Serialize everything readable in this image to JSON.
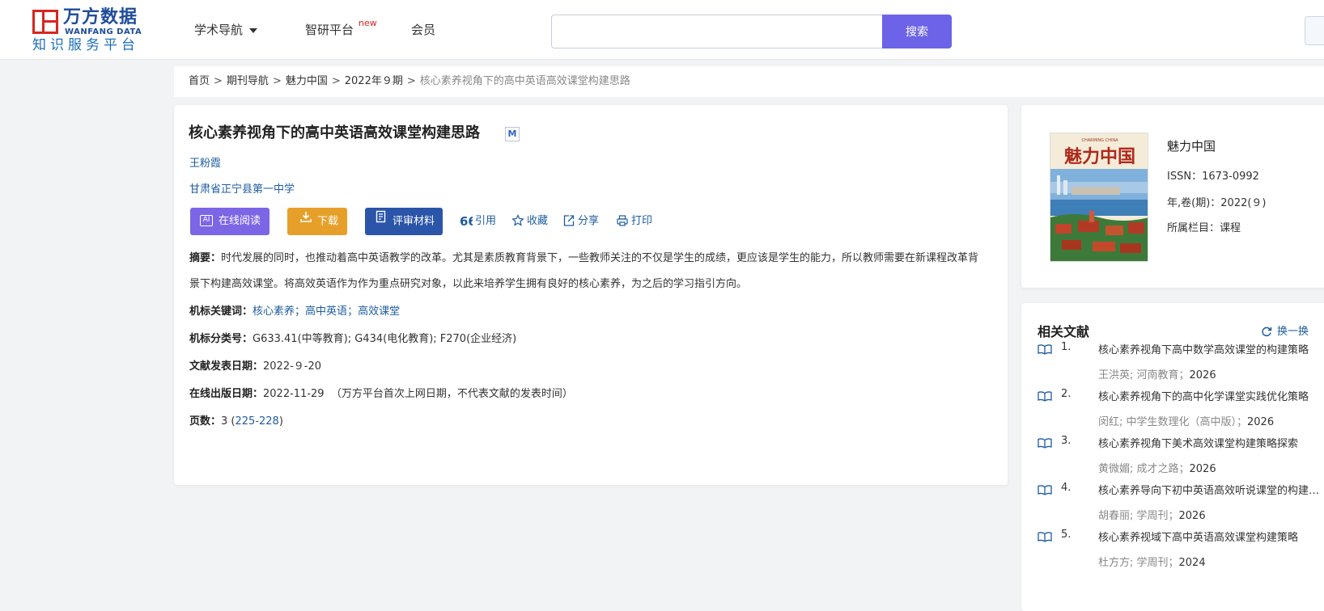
{
  "header": {
    "logo_cn": "万方数据",
    "logo_en": "WANFANG DATA",
    "logo_sub": "知识服务平台",
    "nav": [
      {
        "label": "学术导航"
      },
      {
        "label": "智研平台",
        "badge": "new"
      },
      {
        "label": "会员"
      }
    ],
    "search": {
      "placeholder": "",
      "value": "",
      "button_label": "搜索"
    },
    "accent_color": "#6c63e8"
  },
  "breadcrumb": {
    "items": [
      "首页",
      "期刊导航",
      "魅力中国",
      "2022年９期"
    ],
    "current": "核心素养视角下的高中英语高效课堂构建思路"
  },
  "article": {
    "title": "核心素养视角下的高中英语高效课堂构建思路",
    "badge": "M",
    "author": "王粉霞",
    "organization": "甘肃省正宁县第一中学",
    "buttons": {
      "read": "在线阅读",
      "read_icon": "AI",
      "download": "下载",
      "review": "评审材料"
    },
    "actions": {
      "cite": "引用",
      "favorite": "收藏",
      "share": "分享",
      "print": "打印"
    },
    "abstract_label": "摘要：",
    "abstract": "时代发展的同时，也推动着高中英语教学的改革。尤其是素质教育背景下，一些教师关注的不仅是学生的成绩，更应该是学生的能力，所以教师需要在新课程改革背景下构建高效课堂。将高效英语作为作为重点研究对象，以此来培养学生拥有良好的核心素养，为之后的学习指引方向。",
    "keywords_label": "机标关键词：",
    "keywords": [
      "核心素养",
      "高中英语",
      "高效课堂"
    ],
    "classification_label": "机标分类号：",
    "classification": "G633.41(中等教育); G434(电化教育); F270(企业经济)",
    "pub_date_label": "文献发表日期：",
    "pub_date": "2022-９-20",
    "online_date_label": "在线出版日期：",
    "online_date": "2022-11-29",
    "online_note": "（万方平台首次上网日期，不代表文献的发表时间）",
    "pages_label": "页数：",
    "pages_count": "3",
    "pages_range": "225-228"
  },
  "journal": {
    "name": "魅力中国",
    "issn": "ISSN：1673-0992",
    "year_vol": "年,卷(期)：2022(９)",
    "column": "所属栏目：课程",
    "cover_title": "魅力中国",
    "cover_sub": "CHARMING CHINA"
  },
  "related": {
    "title": "相关文献",
    "refresh_label": "换一换",
    "items": [
      {
        "num": "1.",
        "title": "核心素养视角下高中数学高效课堂的构建策略",
        "source": "王洪英; 河南教育；",
        "year": "2026"
      },
      {
        "num": "2.",
        "title": "核心素养视角下的高中化学课堂实践优化策略",
        "source": "闵红; 中学生数理化（高中版）；",
        "year": "2026"
      },
      {
        "num": "3.",
        "title": "核心素养视角下美术高效课堂构建策略探索",
        "source": "黄微媚; 成才之路；",
        "year": "2026"
      },
      {
        "num": "4.",
        "title": "核心素养导向下初中英语高效听说课堂的构建策略",
        "source": "胡春丽; 学周刊；",
        "year": "2026"
      },
      {
        "num": "5.",
        "title": "核心素养视域下高中英语高效课堂构建策略",
        "source": "杜方方; 学周刊；",
        "year": "2024"
      }
    ]
  }
}
